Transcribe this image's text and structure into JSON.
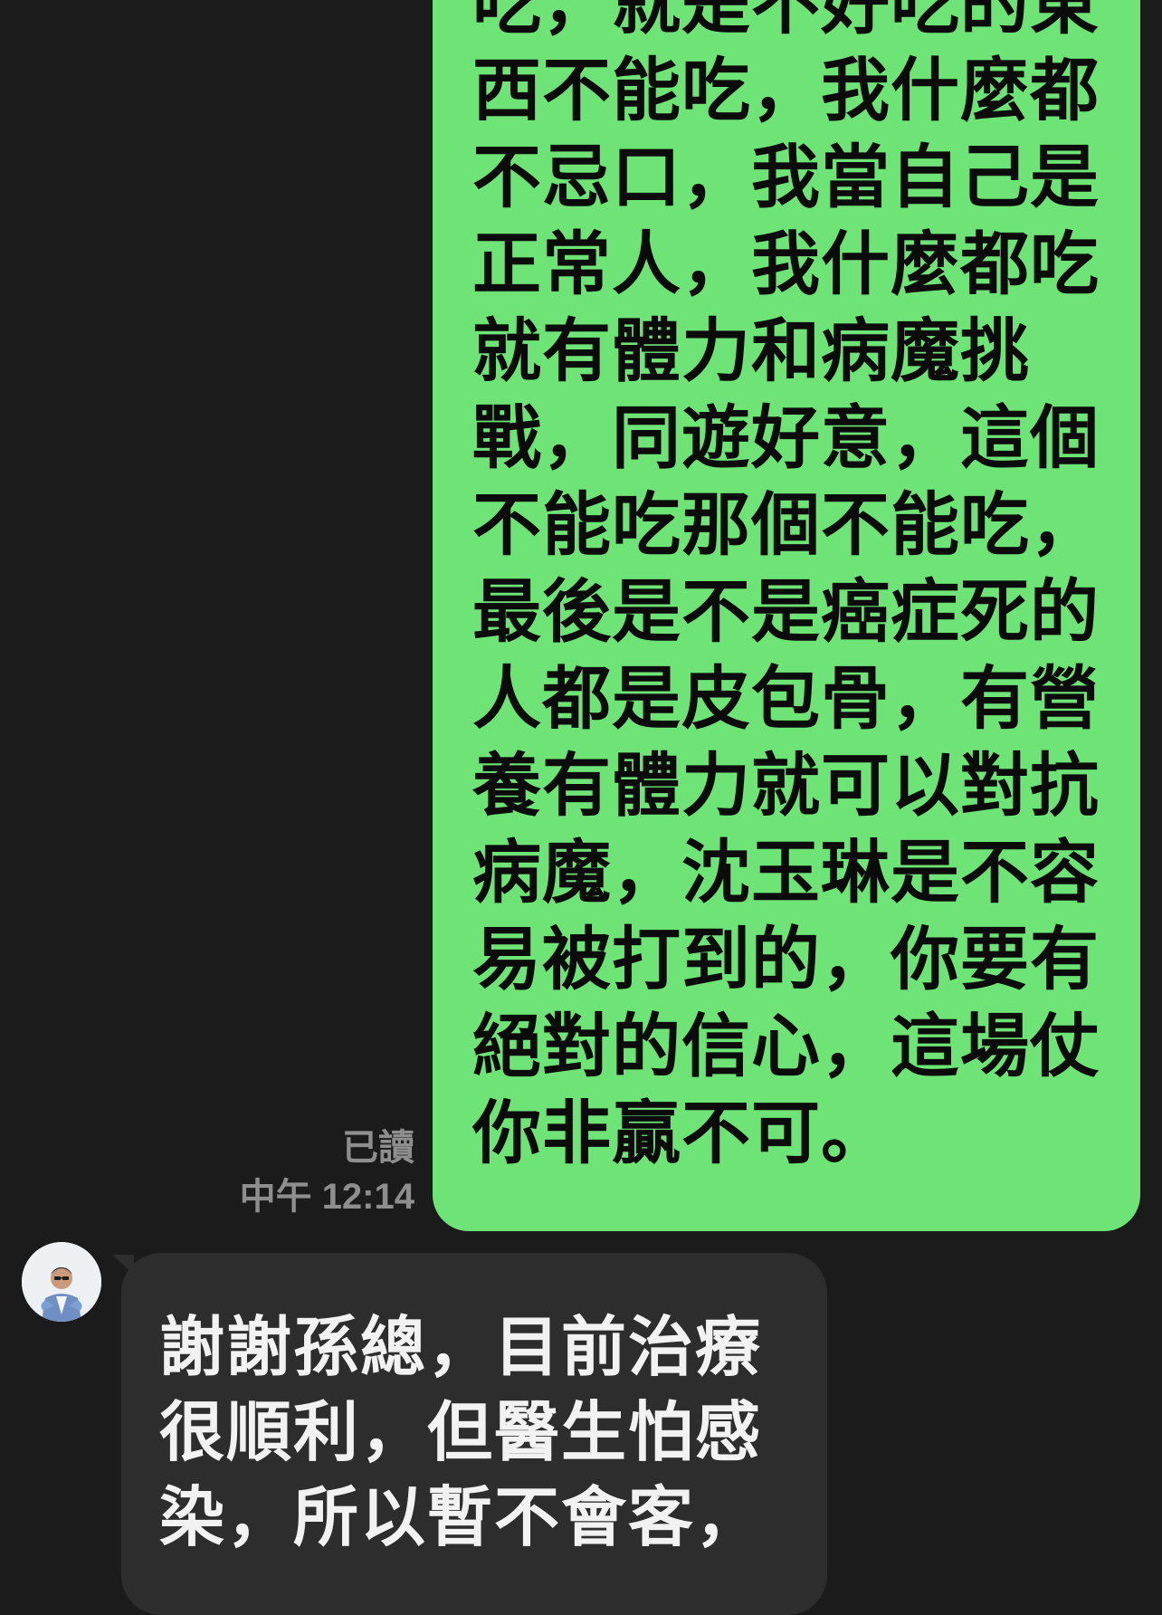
{
  "sent_message": {
    "lines": [
      "吃，就是不好吃的東",
      "西不能吃，我什麼都",
      "不忌口，我當自己是",
      "正常人，我什麼都吃",
      "就有體力和病魔挑",
      "戰，同遊好意，這個",
      "不能吃那個不能吃，",
      "最後是不是癌症死的",
      "人都是皮包骨，有營",
      "養有體力就可以對抗",
      "病魔，沈玉琳是不容",
      "易被打到的，你要有",
      "絕對的信心，這場仗",
      "你非贏不可。"
    ],
    "read_status": "已讀",
    "time": "中午 12:14",
    "bubble_color": "#6fe476"
  },
  "received_message": {
    "lines": [
      "謝謝孫總，目前治療",
      "很順利，但醫生怕感",
      "染，所以暫不會客，"
    ],
    "bubble_color": "#2d2d2d",
    "avatar_icon": "user-avatar"
  },
  "theme": {
    "background": "#1b1b1b",
    "meta_text_color": "#8e8e8e"
  }
}
